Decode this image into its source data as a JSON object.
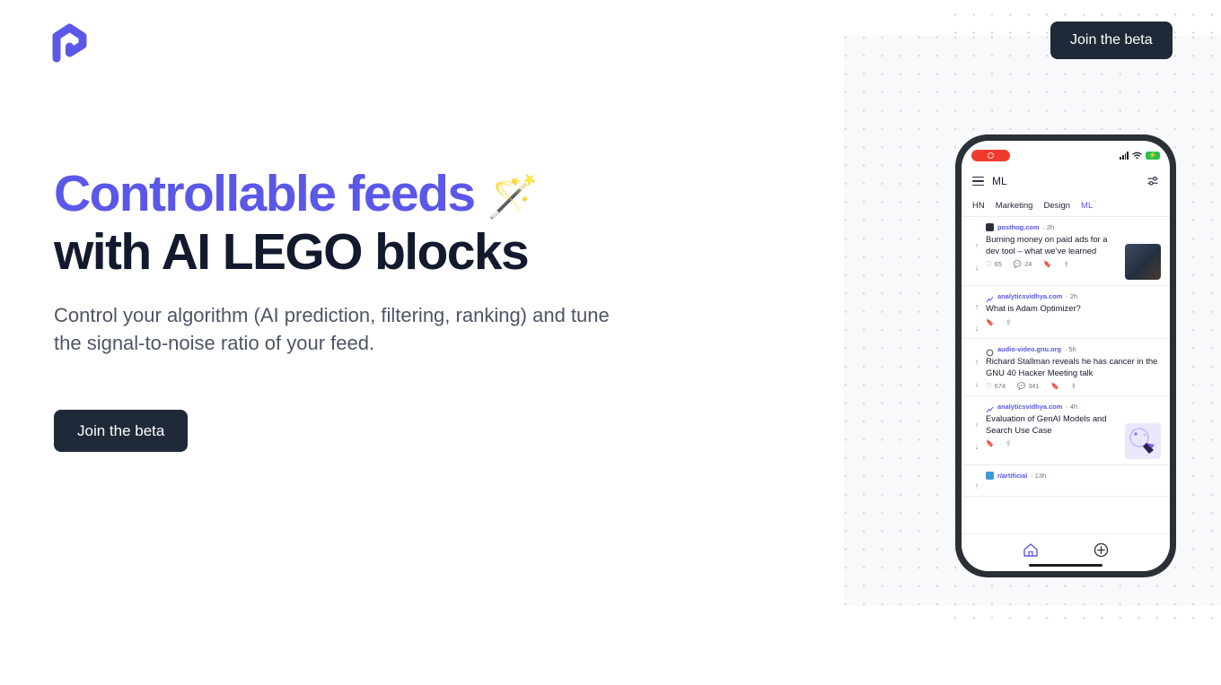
{
  "brand": {
    "logo_icon": "pathway-p-logo",
    "accent_color": "#5b57e8",
    "dark_color": "#1f2937"
  },
  "header": {
    "cta_label": "Join the beta"
  },
  "hero": {
    "headline_line1": "Controllable feeds",
    "headline_emoji": "🪄",
    "headline_line2": "with AI LEGO blocks",
    "subhead": "Control your algorithm (AI prediction, filtering, ranking) and tune the signal-to-noise ratio of your feed.",
    "cta_label": "Join the beta"
  },
  "phone": {
    "statusbar": {
      "recording_indicator": "record-pill",
      "signal_icon": "signal-bars-icon",
      "wifi_icon": "wifi-icon",
      "battery_icon": "battery-charging-icon"
    },
    "app_header": {
      "menu_icon": "hamburger-menu-icon",
      "title": "ML",
      "settings_icon": "sliders-icon"
    },
    "tabs": [
      {
        "label": "HN",
        "active": false
      },
      {
        "label": "Marketing",
        "active": false
      },
      {
        "label": "Design",
        "active": false
      },
      {
        "label": "ML",
        "active": true
      }
    ],
    "feed": [
      {
        "source": "posthog.com",
        "time": "2h",
        "title": "Burning money on paid ads for a dev tool – what we've learned",
        "likes": "65",
        "comments": "24",
        "has_thumb": true
      },
      {
        "source": "analyticsvidhya.com",
        "time": "2h",
        "title": "What is Adam Optimizer?",
        "likes": "",
        "comments": "",
        "has_thumb": false
      },
      {
        "source": "audio-video.gnu.org",
        "time": "5h",
        "title": "Richard Stallman reveals he has cancer in the GNU 40 Hacker Meeting talk",
        "likes": "674",
        "comments": "341",
        "has_thumb": false
      },
      {
        "source": "analyticsvidhya.com",
        "time": "4h",
        "title": "Evaluation of GenAI Models and Search Use Case",
        "likes": "",
        "comments": "",
        "has_thumb": true
      },
      {
        "source": "r/artificial",
        "time": "13h",
        "title": "",
        "likes": "",
        "comments": "",
        "has_thumb": false
      }
    ],
    "bottom_nav": [
      {
        "icon": "home-icon",
        "active": true
      },
      {
        "icon": "plus-circle-icon",
        "active": false
      }
    ]
  }
}
